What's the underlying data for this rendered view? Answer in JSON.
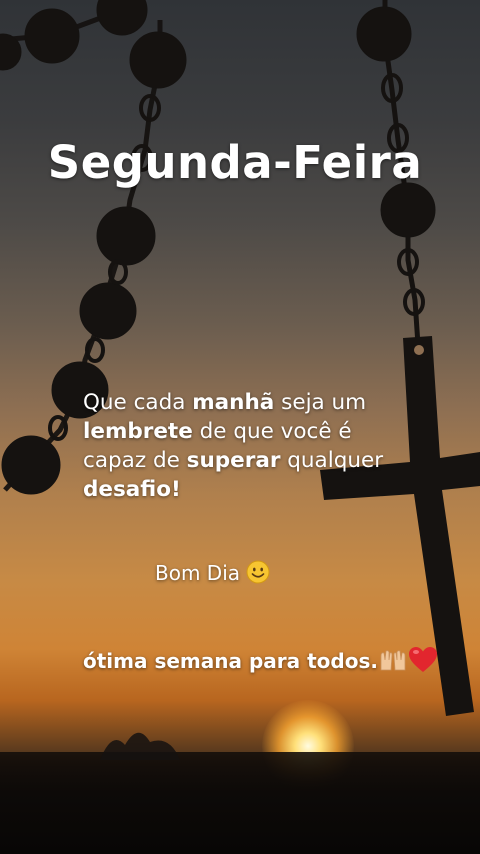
{
  "title": "Segunda-Feira",
  "message": {
    "p1": "Que  cada ",
    "b1": "manhã",
    "p2": "  seja um ",
    "b2": "lembrete",
    "p3": " de que você é capaz de ",
    "b3": "superar",
    "p4": " qualquer ",
    "b4": "desafio!"
  },
  "greeting": "Bom Dia",
  "closing": "ótima semana para todos.",
  "icons": [
    "smiling-face-icon",
    "raised-hands-icon",
    "red-heart-icon"
  ],
  "colors": {
    "text": "#ffffff",
    "sky_top": "#303337",
    "sky_sunset": "#cf8436",
    "silhouette": "#151210"
  }
}
